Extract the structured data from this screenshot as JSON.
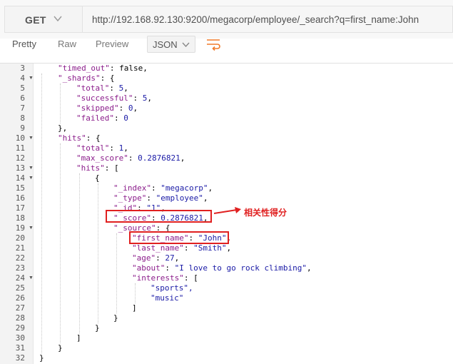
{
  "request": {
    "method": "GET",
    "url": "http://192.168.92.130:9200/megacorp/employee/_search?q=first_name:John"
  },
  "view_tabs": [
    "Pretty",
    "Raw",
    "Preview"
  ],
  "format": "JSON",
  "line_numbers": [
    "3",
    "4",
    "5",
    "6",
    "7",
    "8",
    "9",
    "10",
    "11",
    "12",
    "13",
    "14",
    "15",
    "16",
    "17",
    "18",
    "19",
    "20",
    "21",
    "22",
    "23",
    "24",
    "25",
    "26",
    "27",
    "28",
    "29",
    "30",
    "31",
    "32"
  ],
  "fold_arrow_lines": [
    "4",
    "10",
    "13",
    "14",
    "19",
    "24"
  ],
  "code_lines": [
    "\"timed_out\": false,",
    "\"_shards\": {",
    "\"total\": 5,",
    "\"successful\": 5,",
    "\"skipped\": 0,",
    "\"failed\": 0",
    "},",
    "\"hits\": {",
    "\"total\": 1,",
    "\"max_score\": 0.2876821,",
    "\"hits\": [",
    "{",
    "\"_index\": \"megacorp\",",
    "\"_type\": \"employee\",",
    "\"_id\": \"1\",",
    "\"_score\": 0.2876821,",
    "\"_source\": {",
    "\"first_name\": \"John\",",
    "\"last_name\": \"Smith\",",
    "\"age\": 27,",
    "\"about\": \"I love to go rock climbing\",",
    "\"interests\": [",
    "\"sports\",",
    "\"music\"",
    "]",
    "}",
    "}",
    "]",
    "}",
    "}"
  ],
  "annotation": "相关性得分",
  "colors": {
    "key": "#8b1d8b",
    "value": "#1a1aa6",
    "highlight": "#e02020"
  },
  "icons": [
    "chevron-down-icon",
    "wrap-lines-icon",
    "fold-arrow-icon",
    "red-arrow"
  ]
}
